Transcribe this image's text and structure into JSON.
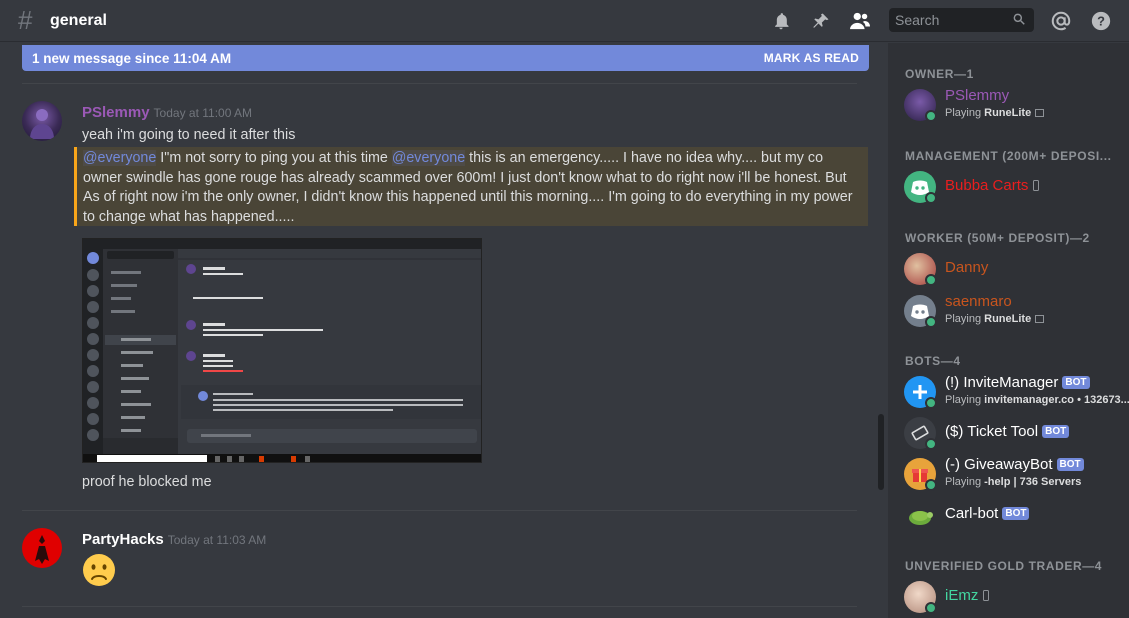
{
  "header": {
    "channel_name": "general",
    "search_placeholder": "Search"
  },
  "new_messages_bar": {
    "text": "1 new message since 11:04 AM",
    "action": "MARK AS READ"
  },
  "messages": [
    {
      "author": "PSlemmy",
      "author_color": "#9b59b6",
      "timestamp": "Today at 11:00 AM",
      "lines": [
        "yeah i'm going to need it after this",
        "proof he blocked me"
      ],
      "mention_text": {
        "m1": "@everyone",
        "t1": " I\"m not sorry to ping you at this time ",
        "m2": "@everyone",
        "t2": " this is an emergency..... I have no idea why.... but my co owner swindle has gone rouge has already scammed over 600m! I just don't know what to do right now i'll be honest. But As of right now i'm the only owner, I didn't know this happened until this morning.... I'm going to do everything in my power to change what has happened....."
      }
    },
    {
      "author": "PartyHacks",
      "author_color": "#ffffff",
      "timestamp": "Today at 11:03 AM",
      "emoji": "😟"
    }
  ],
  "member_list": {
    "groups": [
      {
        "title": "OWNER—1",
        "members": [
          {
            "name": "PSlemmy",
            "color": "#9b59b6",
            "activity_prefix": "Playing ",
            "activity": "RuneLite",
            "avatar_color": "#3a3f6b"
          }
        ]
      },
      {
        "title": "MANAGEMENT (200M+ DEPOSI...",
        "members": [
          {
            "name": "Bubba Carts",
            "color": "#e91e1e",
            "avatar_color": "#43b581"
          }
        ]
      },
      {
        "title": "WORKER (50M+ DEPOSIT)—2",
        "members": [
          {
            "name": "Danny",
            "color": "#c8551e",
            "avatar_color": "#a33a3a"
          },
          {
            "name": "saenmaro",
            "color": "#c8551e",
            "activity_prefix": "Playing ",
            "activity": "RuneLite",
            "avatar_color": "#747f8d"
          }
        ]
      },
      {
        "title": "BOTS—4",
        "members": [
          {
            "name": "(!) InviteManager",
            "color": "#ffffff",
            "badge": "BOT",
            "activity_prefix": "Playing ",
            "activity": "invitemanager.co • 132673...",
            "avatar_color": "#2196f3"
          },
          {
            "name": "($) Ticket Tool",
            "color": "#ffffff",
            "badge": "BOT",
            "avatar_color": "#3b3e44"
          },
          {
            "name": "(-) GiveawayBot",
            "color": "#ffffff",
            "badge": "BOT",
            "activity_prefix": "Playing ",
            "activity": "-help | 736 Servers",
            "avatar_color": "#e8a33b"
          },
          {
            "name": "Carl-bot",
            "color": "#ffffff",
            "badge": "BOT",
            "avatar_color": "#6cab3c"
          }
        ]
      },
      {
        "title": "UNVERIFIED GOLD TRADER—4",
        "members": [
          {
            "name": "iEmz",
            "color": "#43d6a0",
            "avatar_color": "#d8c2b0"
          }
        ]
      }
    ]
  },
  "colors": {
    "background": "#36393f",
    "sidebar": "#2f3136",
    "accent": "#7289da",
    "online": "#43b581",
    "mention_border": "#faa61a"
  }
}
